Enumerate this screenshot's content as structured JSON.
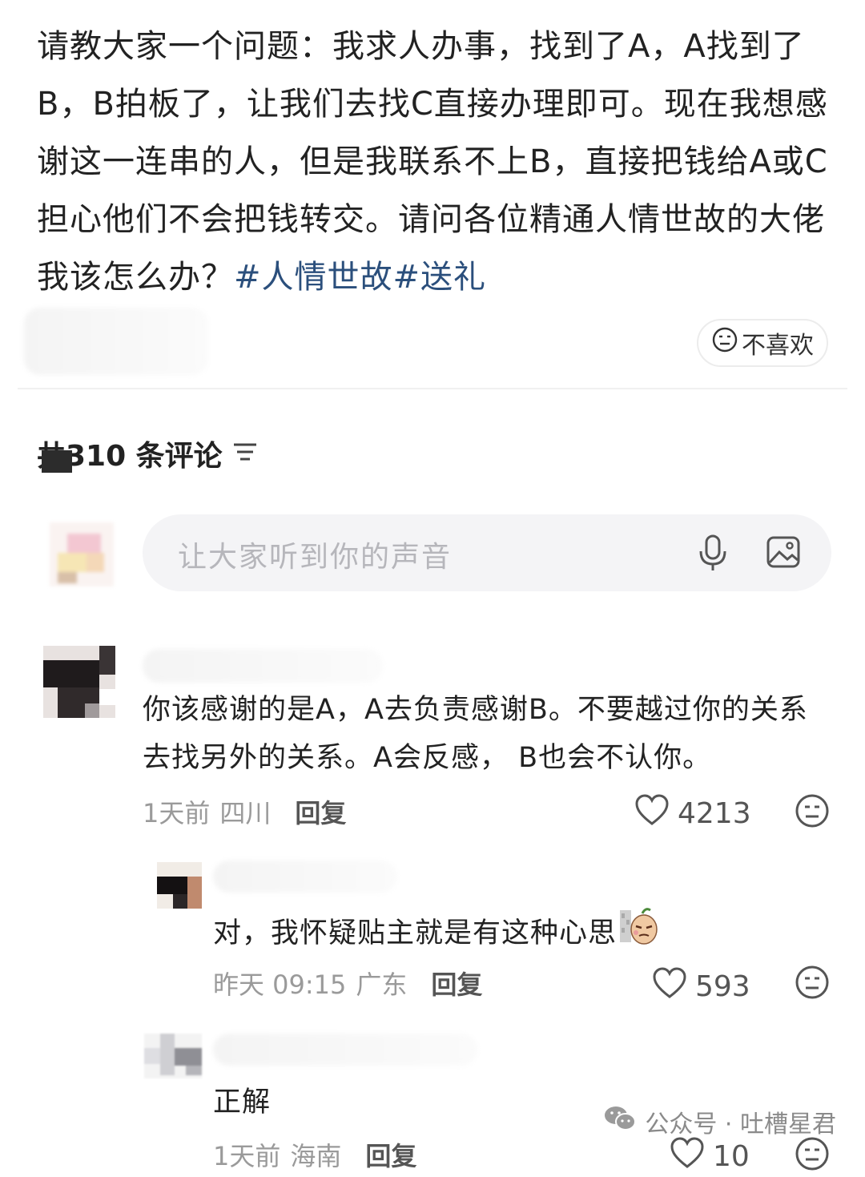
{
  "post": {
    "text": "请教大家一个问题：我求人办事，找到了A，A找到了B，B拍板了，让我们去找C直接办理即可。现在我想感谢这一连串的人，但是我联系不上B，直接把钱给A或C担心他们不会把钱转交。请问各位精通人情世故的大佬我该怎么办？",
    "hashtags": "#人情世故#送礼",
    "dislike_label": "不喜欢"
  },
  "comments_header": {
    "count_label": "共310 条评论"
  },
  "composer": {
    "placeholder": "让大家听到你的声音"
  },
  "comments": [
    {
      "text": "你该感谢的是A，A去负责感谢B。不要越过你的关系去找另外的关系。A会反感， B也会不认你。",
      "time": "1天前",
      "location": "四川",
      "reply_label": "回复",
      "likes": "4213"
    }
  ],
  "replies": [
    {
      "text": "对，我怀疑贴主就是有这种心思",
      "time": "昨天 09:15",
      "location": "广东",
      "reply_label": "回复",
      "likes": "593"
    },
    {
      "text": "正解",
      "time": "1天前",
      "location": "海南",
      "reply_label": "回复",
      "likes": "10"
    }
  ],
  "watermark": {
    "text": "公众号 · 吐槽星君"
  },
  "icons": [
    "dislike-face-icon",
    "sort-icon",
    "microphone-icon",
    "image-icon",
    "heart-icon",
    "meh-face-icon",
    "wechat-icon",
    "sticker-emoji"
  ]
}
